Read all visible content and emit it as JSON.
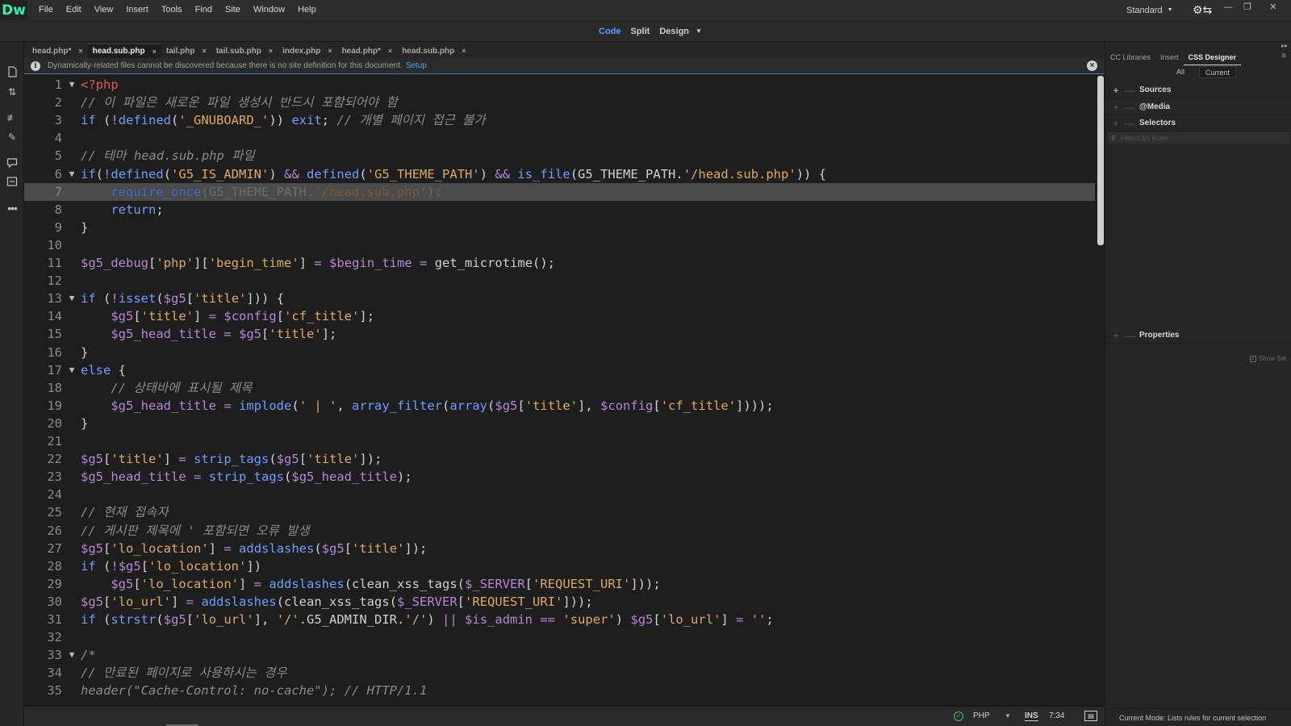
{
  "app": {
    "logo": "Dw",
    "menu": [
      "File",
      "Edit",
      "View",
      "Insert",
      "Tools",
      "Find",
      "Site",
      "Window",
      "Help"
    ],
    "workspace": "Standard"
  },
  "view_switch": {
    "code": "Code",
    "split": "Split",
    "design": "Design",
    "active": "Code"
  },
  "tabs": [
    {
      "label": "head.php*",
      "active": false
    },
    {
      "label": "head.sub.php",
      "active": true
    },
    {
      "label": "tail.php",
      "active": false
    },
    {
      "label": "tail.sub.php",
      "active": false
    },
    {
      "label": "index.php",
      "active": false
    },
    {
      "label": "head.php*",
      "active": false
    },
    {
      "label": "head.sub.php",
      "active": false
    }
  ],
  "info_bar": {
    "message": "Dynamically-related files cannot be discovered because there is no site definition for this document.",
    "link": "Setup"
  },
  "colors": {
    "keyword": "#6b9eff",
    "string": "#e0a85c",
    "variable": "#b884d8",
    "comment": "#8a8a8a",
    "php_tag": "#e2554f",
    "accent": "#4aa3ff",
    "logo": "#2ef2a3"
  },
  "editor": {
    "highlighted_line": 7,
    "lines": [
      {
        "n": 1,
        "fold": true,
        "tokens": [
          [
            "php",
            "<?php"
          ]
        ]
      },
      {
        "n": 2,
        "tokens": [
          [
            "cmt",
            "// 이 파일은 새로운 파일 생성시 반드시 포함되어야 함"
          ]
        ]
      },
      {
        "n": 3,
        "tokens": [
          [
            "kw",
            "if"
          ],
          [
            "txt",
            " ("
          ],
          [
            "op",
            "!"
          ],
          [
            "kw",
            "defined"
          ],
          [
            "txt",
            "("
          ],
          [
            "str",
            "'_GNUBOARD_'"
          ],
          [
            "txt",
            ")) "
          ],
          [
            "kw",
            "exit"
          ],
          [
            "txt",
            "; "
          ],
          [
            "cmt",
            "// 개별 페이지 접근 불가"
          ]
        ]
      },
      {
        "n": 4,
        "tokens": []
      },
      {
        "n": 5,
        "tokens": [
          [
            "cmt",
            "// 테마 head.sub.php 파일"
          ]
        ]
      },
      {
        "n": 6,
        "fold": true,
        "tokens": [
          [
            "kw",
            "if"
          ],
          [
            "txt",
            "("
          ],
          [
            "op",
            "!"
          ],
          [
            "kw",
            "defined"
          ],
          [
            "txt",
            "("
          ],
          [
            "str",
            "'G5_IS_ADMIN'"
          ],
          [
            "txt",
            ") "
          ],
          [
            "op",
            "&&"
          ],
          [
            "txt",
            " "
          ],
          [
            "kw",
            "defined"
          ],
          [
            "txt",
            "("
          ],
          [
            "str",
            "'G5_THEME_PATH'"
          ],
          [
            "txt",
            ") "
          ],
          [
            "op",
            "&&"
          ],
          [
            "txt",
            " "
          ],
          [
            "kw",
            "is_file"
          ],
          [
            "txt",
            "(G5_THEME_PATH."
          ],
          [
            "str",
            "'/head.sub.php'"
          ],
          [
            "txt",
            ")) {"
          ]
        ]
      },
      {
        "n": 7,
        "tokens": [
          [
            "txt",
            "    "
          ],
          [
            "dkw",
            "require_once"
          ],
          [
            "dtxt",
            "(G5_THEME_PATH."
          ],
          [
            "dstr",
            "'/head.sub.php'"
          ],
          [
            "dtxt",
            ");"
          ]
        ]
      },
      {
        "n": 8,
        "tokens": [
          [
            "txt",
            "    "
          ],
          [
            "kw",
            "return"
          ],
          [
            "txt",
            ";"
          ]
        ]
      },
      {
        "n": 9,
        "tokens": [
          [
            "txt",
            "}"
          ]
        ]
      },
      {
        "n": 10,
        "tokens": []
      },
      {
        "n": 11,
        "tokens": [
          [
            "var",
            "$g5_debug"
          ],
          [
            "txt",
            "["
          ],
          [
            "str",
            "'php'"
          ],
          [
            "txt",
            "]["
          ],
          [
            "str",
            "'begin_time'"
          ],
          [
            "txt",
            "] "
          ],
          [
            "op",
            "="
          ],
          [
            "txt",
            " "
          ],
          [
            "var",
            "$begin_time"
          ],
          [
            "txt",
            " "
          ],
          [
            "op",
            "="
          ],
          [
            "txt",
            " get_microtime();"
          ]
        ]
      },
      {
        "n": 12,
        "tokens": []
      },
      {
        "n": 13,
        "fold": true,
        "tokens": [
          [
            "kw",
            "if"
          ],
          [
            "txt",
            " ("
          ],
          [
            "op",
            "!"
          ],
          [
            "kw",
            "isset"
          ],
          [
            "txt",
            "("
          ],
          [
            "var",
            "$g5"
          ],
          [
            "txt",
            "["
          ],
          [
            "str",
            "'title'"
          ],
          [
            "txt",
            "])) {"
          ]
        ]
      },
      {
        "n": 14,
        "tokens": [
          [
            "txt",
            "    "
          ],
          [
            "var",
            "$g5"
          ],
          [
            "txt",
            "["
          ],
          [
            "str",
            "'title'"
          ],
          [
            "txt",
            "] "
          ],
          [
            "op",
            "="
          ],
          [
            "txt",
            " "
          ],
          [
            "var",
            "$config"
          ],
          [
            "txt",
            "["
          ],
          [
            "str",
            "'cf_title'"
          ],
          [
            "txt",
            "];"
          ]
        ]
      },
      {
        "n": 15,
        "tokens": [
          [
            "txt",
            "    "
          ],
          [
            "var",
            "$g5_head_title"
          ],
          [
            "txt",
            " "
          ],
          [
            "op",
            "="
          ],
          [
            "txt",
            " "
          ],
          [
            "var",
            "$g5"
          ],
          [
            "txt",
            "["
          ],
          [
            "str",
            "'title'"
          ],
          [
            "txt",
            "];"
          ]
        ]
      },
      {
        "n": 16,
        "tokens": [
          [
            "txt",
            "}"
          ]
        ]
      },
      {
        "n": 17,
        "fold": true,
        "tokens": [
          [
            "kw",
            "else"
          ],
          [
            "txt",
            " {"
          ]
        ]
      },
      {
        "n": 18,
        "tokens": [
          [
            "txt",
            "    "
          ],
          [
            "cmt",
            "// 상태바에 표시될 제목"
          ]
        ]
      },
      {
        "n": 19,
        "tokens": [
          [
            "txt",
            "    "
          ],
          [
            "var",
            "$g5_head_title"
          ],
          [
            "txt",
            " "
          ],
          [
            "op",
            "="
          ],
          [
            "txt",
            " "
          ],
          [
            "kw",
            "implode"
          ],
          [
            "txt",
            "("
          ],
          [
            "str",
            "' | '"
          ],
          [
            "txt",
            ", "
          ],
          [
            "kw",
            "array_filter"
          ],
          [
            "txt",
            "("
          ],
          [
            "kw",
            "array"
          ],
          [
            "txt",
            "("
          ],
          [
            "var",
            "$g5"
          ],
          [
            "txt",
            "["
          ],
          [
            "str",
            "'title'"
          ],
          [
            "txt",
            "], "
          ],
          [
            "var",
            "$config"
          ],
          [
            "txt",
            "["
          ],
          [
            "str",
            "'cf_title'"
          ],
          [
            "txt",
            "])));"
          ]
        ]
      },
      {
        "n": 20,
        "tokens": [
          [
            "txt",
            "}"
          ]
        ]
      },
      {
        "n": 21,
        "tokens": []
      },
      {
        "n": 22,
        "tokens": [
          [
            "var",
            "$g5"
          ],
          [
            "txt",
            "["
          ],
          [
            "str",
            "'title'"
          ],
          [
            "txt",
            "] "
          ],
          [
            "op",
            "="
          ],
          [
            "txt",
            " "
          ],
          [
            "kw",
            "strip_tags"
          ],
          [
            "txt",
            "("
          ],
          [
            "var",
            "$g5"
          ],
          [
            "txt",
            "["
          ],
          [
            "str",
            "'title'"
          ],
          [
            "txt",
            "]);"
          ]
        ]
      },
      {
        "n": 23,
        "tokens": [
          [
            "var",
            "$g5_head_title"
          ],
          [
            "txt",
            " "
          ],
          [
            "op",
            "="
          ],
          [
            "txt",
            " "
          ],
          [
            "kw",
            "strip_tags"
          ],
          [
            "txt",
            "("
          ],
          [
            "var",
            "$g5_head_title"
          ],
          [
            "txt",
            ");"
          ]
        ]
      },
      {
        "n": 24,
        "tokens": []
      },
      {
        "n": 25,
        "tokens": [
          [
            "cmt",
            "// 현재 접속자"
          ]
        ]
      },
      {
        "n": 26,
        "tokens": [
          [
            "cmt",
            "// 게시판 제목에 ' 포함되면 오류 발생"
          ]
        ]
      },
      {
        "n": 27,
        "tokens": [
          [
            "var",
            "$g5"
          ],
          [
            "txt",
            "["
          ],
          [
            "str",
            "'lo_location'"
          ],
          [
            "txt",
            "] "
          ],
          [
            "op",
            "="
          ],
          [
            "txt",
            " "
          ],
          [
            "kw",
            "addslashes"
          ],
          [
            "txt",
            "("
          ],
          [
            "var",
            "$g5"
          ],
          [
            "txt",
            "["
          ],
          [
            "str",
            "'title'"
          ],
          [
            "txt",
            "]);"
          ]
        ]
      },
      {
        "n": 28,
        "tokens": [
          [
            "kw",
            "if"
          ],
          [
            "txt",
            " ("
          ],
          [
            "op",
            "!"
          ],
          [
            "var",
            "$g5"
          ],
          [
            "txt",
            "["
          ],
          [
            "str",
            "'lo_location'"
          ],
          [
            "txt",
            "])"
          ]
        ]
      },
      {
        "n": 29,
        "tokens": [
          [
            "txt",
            "    "
          ],
          [
            "var",
            "$g5"
          ],
          [
            "txt",
            "["
          ],
          [
            "str",
            "'lo_location'"
          ],
          [
            "txt",
            "] "
          ],
          [
            "op",
            "="
          ],
          [
            "txt",
            " "
          ],
          [
            "kw",
            "addslashes"
          ],
          [
            "txt",
            "(clean_xss_tags("
          ],
          [
            "var",
            "$_SERVER"
          ],
          [
            "txt",
            "["
          ],
          [
            "str",
            "'REQUEST_URI'"
          ],
          [
            "txt",
            "]));"
          ]
        ]
      },
      {
        "n": 30,
        "tokens": [
          [
            "var",
            "$g5"
          ],
          [
            "txt",
            "["
          ],
          [
            "str",
            "'lo_url'"
          ],
          [
            "txt",
            "] "
          ],
          [
            "op",
            "="
          ],
          [
            "txt",
            " "
          ],
          [
            "kw",
            "addslashes"
          ],
          [
            "txt",
            "(clean_xss_tags("
          ],
          [
            "var",
            "$_SERVER"
          ],
          [
            "txt",
            "["
          ],
          [
            "str",
            "'REQUEST_URI'"
          ],
          [
            "txt",
            "]));"
          ]
        ]
      },
      {
        "n": 31,
        "tokens": [
          [
            "kw",
            "if"
          ],
          [
            "txt",
            " ("
          ],
          [
            "kw",
            "strstr"
          ],
          [
            "txt",
            "("
          ],
          [
            "var",
            "$g5"
          ],
          [
            "txt",
            "["
          ],
          [
            "str",
            "'lo_url'"
          ],
          [
            "txt",
            "], "
          ],
          [
            "str",
            "'/'"
          ],
          [
            "txt",
            ".G5_ADMIN_DIR."
          ],
          [
            "str",
            "'/'"
          ],
          [
            "txt",
            ") "
          ],
          [
            "op",
            "||"
          ],
          [
            "txt",
            " "
          ],
          [
            "var",
            "$is_admin"
          ],
          [
            "txt",
            " "
          ],
          [
            "op",
            "=="
          ],
          [
            "txt",
            " "
          ],
          [
            "str",
            "'super'"
          ],
          [
            "txt",
            ") "
          ],
          [
            "var",
            "$g5"
          ],
          [
            "txt",
            "["
          ],
          [
            "str",
            "'lo_url'"
          ],
          [
            "txt",
            "] "
          ],
          [
            "op",
            "="
          ],
          [
            "txt",
            " "
          ],
          [
            "str",
            "''"
          ],
          [
            "txt",
            ";"
          ]
        ]
      },
      {
        "n": 32,
        "tokens": []
      },
      {
        "n": 33,
        "fold": true,
        "tokens": [
          [
            "cmt",
            "/*"
          ]
        ]
      },
      {
        "n": 34,
        "tokens": [
          [
            "cmt",
            "// 만료된 페이지로 사용하시는 경우"
          ]
        ]
      },
      {
        "n": 35,
        "tokens": [
          [
            "cmt",
            "header(\"Cache-Control: no-cache\"); // HTTP/1.1"
          ]
        ]
      }
    ]
  },
  "status_bar": {
    "language": "PHP",
    "mode": "INS",
    "position": "7:34"
  },
  "right_panel": {
    "tabs": [
      {
        "label": "CC Libraries",
        "active": false
      },
      {
        "label": "Insert",
        "active": false
      },
      {
        "label": "CSS Designer",
        "active": true
      }
    ],
    "scope": {
      "all": "All",
      "current": "Current"
    },
    "sections": {
      "sources": "Sources",
      "media": "@Media",
      "selectors": "Selectors",
      "properties": "Properties"
    },
    "filter_placeholder": "Filter CSS Rules",
    "show_set": "Show Set",
    "status": "Current Mode: Lists rules for current selection"
  }
}
